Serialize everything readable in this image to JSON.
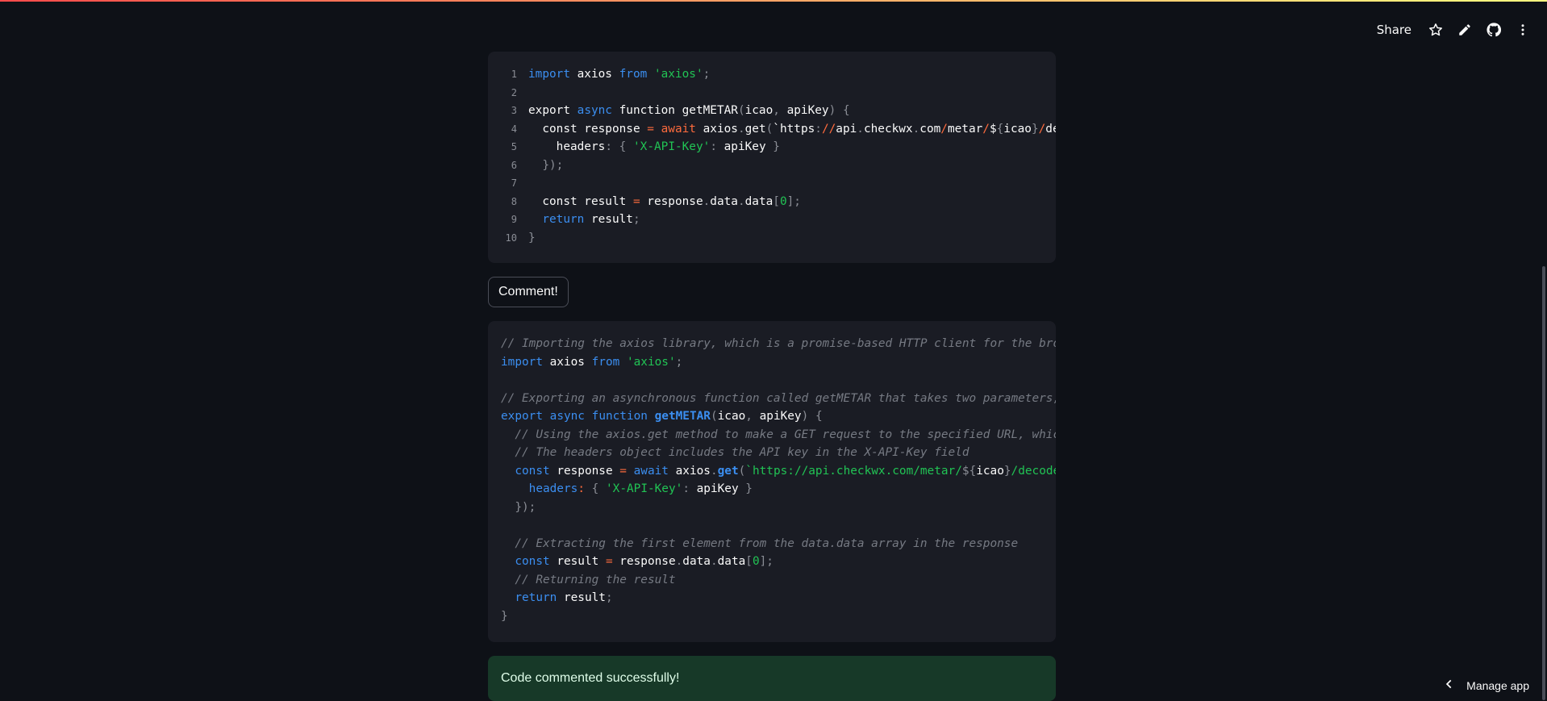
{
  "header": {
    "share_label": "Share",
    "icons": [
      "star-icon",
      "pencil-icon",
      "github-icon",
      "more-vertical-icon"
    ]
  },
  "code_original": {
    "language": "javascript",
    "lines": [
      [
        [
          "kw",
          "import"
        ],
        [
          "cn",
          " axios "
        ],
        [
          "kw",
          "from"
        ],
        [
          "cn",
          " "
        ],
        [
          "str",
          "'axios'"
        ],
        [
          "pn",
          ";"
        ]
      ],
      [],
      [
        [
          "cn",
          "export "
        ],
        [
          "kw",
          "async"
        ],
        [
          "cn",
          " function getMETAR"
        ],
        [
          "pn",
          "("
        ],
        [
          "cn",
          "icao"
        ],
        [
          "pn",
          ","
        ],
        [
          "cn",
          " apiKey"
        ],
        [
          "pn",
          ")"
        ],
        [
          "cn",
          " "
        ],
        [
          "pn",
          "{"
        ]
      ],
      [
        [
          "cn",
          "  const response "
        ],
        [
          "op",
          "="
        ],
        [
          "cn",
          " "
        ],
        [
          "op",
          "await"
        ],
        [
          "cn",
          " axios"
        ],
        [
          "pn",
          "."
        ],
        [
          "cn",
          "get"
        ],
        [
          "pn",
          "("
        ],
        [
          "cn",
          "`https"
        ],
        [
          "pn",
          ":"
        ],
        [
          "op",
          "//"
        ],
        [
          "cn",
          "api"
        ],
        [
          "pn",
          "."
        ],
        [
          "cn",
          "checkwx"
        ],
        [
          "pn",
          "."
        ],
        [
          "cn",
          "com"
        ],
        [
          "op",
          "/"
        ],
        [
          "cn",
          "metar"
        ],
        [
          "op",
          "/"
        ],
        [
          "cn",
          "$"
        ],
        [
          "pn",
          "{"
        ],
        [
          "cn",
          "icao"
        ],
        [
          "pn",
          "}"
        ],
        [
          "op",
          "/"
        ],
        [
          "cn",
          "decoded`"
        ],
        [
          "pn",
          ","
        ],
        [
          "cn",
          " "
        ],
        [
          "pn",
          "{"
        ]
      ],
      [
        [
          "cn",
          "    headers"
        ],
        [
          "pn",
          ":"
        ],
        [
          "cn",
          " "
        ],
        [
          "pn",
          "{"
        ],
        [
          "cn",
          " "
        ],
        [
          "str",
          "'X-API-Key'"
        ],
        [
          "pn",
          ":"
        ],
        [
          "cn",
          " apiKey "
        ],
        [
          "pn",
          "}"
        ]
      ],
      [
        [
          "cn",
          "  "
        ],
        [
          "pn",
          "});"
        ]
      ],
      [],
      [
        [
          "cn",
          "  const result "
        ],
        [
          "op",
          "="
        ],
        [
          "cn",
          " response"
        ],
        [
          "pn",
          "."
        ],
        [
          "cn",
          "data"
        ],
        [
          "pn",
          "."
        ],
        [
          "cn",
          "data"
        ],
        [
          "pn",
          "["
        ],
        [
          "num",
          "0"
        ],
        [
          "pn",
          "];"
        ]
      ],
      [
        [
          "cn",
          "  "
        ],
        [
          "kw",
          "return"
        ],
        [
          "cn",
          " result"
        ],
        [
          "pn",
          ";"
        ]
      ],
      [
        [
          "pn",
          "}"
        ]
      ]
    ]
  },
  "comment_button_label": "Comment!",
  "code_commented": {
    "language": "javascript",
    "lines": [
      [
        [
          "cm",
          "// Importing the axios library, which is a promise-based HTTP client for the browser and node.js"
        ]
      ],
      [
        [
          "kw",
          "import"
        ],
        [
          "cn",
          " axios "
        ],
        [
          "kw",
          "from"
        ],
        [
          "cn",
          " "
        ],
        [
          "str",
          "'axios'"
        ],
        [
          "pn",
          ";"
        ]
      ],
      [],
      [
        [
          "cm",
          "// Exporting an asynchronous function called getMETAR that takes two parameters, icao and apiKey"
        ]
      ],
      [
        [
          "kw",
          "export"
        ],
        [
          "cn",
          " "
        ],
        [
          "kw",
          "async"
        ],
        [
          "cn",
          " "
        ],
        [
          "kw",
          "function"
        ],
        [
          "cn",
          " "
        ],
        [
          "fn",
          "getMETAR"
        ],
        [
          "pn",
          "("
        ],
        [
          "cn",
          "icao"
        ],
        [
          "pn",
          ","
        ],
        [
          "cn",
          " apiKey"
        ],
        [
          "pn",
          ")"
        ],
        [
          "cn",
          " "
        ],
        [
          "pn",
          "{"
        ]
      ],
      [
        [
          "cm",
          "  // Using the axios.get method to make a GET request to the specified URL, which includes the icao"
        ]
      ],
      [
        [
          "cm",
          "  // The headers object includes the API key in the X-API-Key field"
        ]
      ],
      [
        [
          "cn",
          "  "
        ],
        [
          "kw",
          "const"
        ],
        [
          "cn",
          " response "
        ],
        [
          "op",
          "="
        ],
        [
          "cn",
          " "
        ],
        [
          "kw",
          "await"
        ],
        [
          "cn",
          " axios"
        ],
        [
          "pn",
          "."
        ],
        [
          "fn",
          "get"
        ],
        [
          "pn",
          "("
        ],
        [
          "str",
          "`https://api.checkwx.com/metar/"
        ],
        [
          "pn",
          "${"
        ],
        [
          "cn",
          "icao"
        ],
        [
          "pn",
          "}"
        ],
        [
          "str",
          "/decoded`"
        ],
        [
          "pn",
          ","
        ],
        [
          "cn",
          " "
        ],
        [
          "pn",
          "{"
        ]
      ],
      [
        [
          "cn",
          "    "
        ],
        [
          "prop",
          "headers"
        ],
        [
          "op",
          ":"
        ],
        [
          "cn",
          " "
        ],
        [
          "pn",
          "{"
        ],
        [
          "cn",
          " "
        ],
        [
          "str",
          "'X-API-Key'"
        ],
        [
          "pn",
          ":"
        ],
        [
          "cn",
          " apiKey "
        ],
        [
          "pn",
          "}"
        ]
      ],
      [
        [
          "cn",
          "  "
        ],
        [
          "pn",
          "});"
        ]
      ],
      [],
      [
        [
          "cm",
          "  // Extracting the first element from the data.data array in the response"
        ]
      ],
      [
        [
          "cn",
          "  "
        ],
        [
          "kw",
          "const"
        ],
        [
          "cn",
          " result "
        ],
        [
          "op",
          "="
        ],
        [
          "cn",
          " response"
        ],
        [
          "pn",
          "."
        ],
        [
          "cn",
          "data"
        ],
        [
          "pn",
          "."
        ],
        [
          "cn",
          "data"
        ],
        [
          "pn",
          "["
        ],
        [
          "num",
          "0"
        ],
        [
          "pn",
          "];"
        ]
      ],
      [
        [
          "cm",
          "  // Returning the result"
        ]
      ],
      [
        [
          "cn",
          "  "
        ],
        [
          "kw",
          "return"
        ],
        [
          "cn",
          " result"
        ],
        [
          "pn",
          ";"
        ]
      ],
      [
        [
          "pn",
          "}"
        ]
      ]
    ]
  },
  "success_message": "Code commented successfully!",
  "footer": {
    "manage_app_label": "Manage app"
  }
}
